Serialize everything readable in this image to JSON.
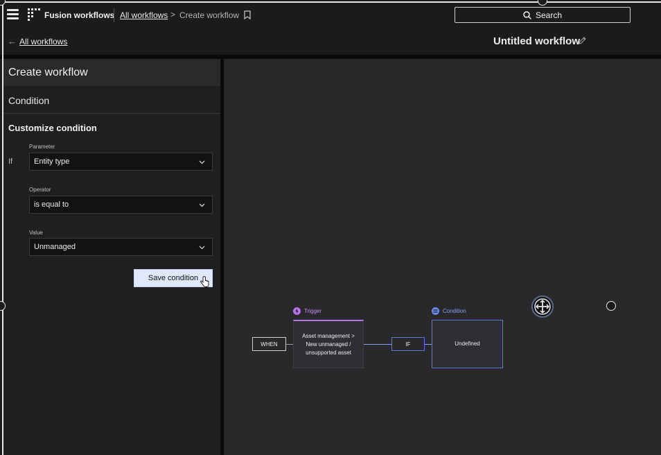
{
  "topbar": {
    "app_title": "Fusion workflows",
    "breadcrumb_link": "All workflows",
    "breadcrumb_separator": ">",
    "breadcrumb_current": "Create workflow",
    "search_label": "Search"
  },
  "subbar": {
    "back_link": "All workflows",
    "workflow_title": "Untitled workflow"
  },
  "panel": {
    "title": "Create workflow",
    "section": "Condition",
    "subtitle": "Customize condition",
    "if_label": "If",
    "parameter": {
      "label": "Parameter",
      "value": "Entity type"
    },
    "operator": {
      "label": "Operator",
      "value": "is equal to"
    },
    "value": {
      "label": "Value",
      "value": "Unmanaged"
    },
    "save_button": "Save condition"
  },
  "canvas": {
    "when_label": "WHEN",
    "trigger": {
      "header": "Trigger",
      "line1": "Asset management >",
      "line2": "New unmanaged /",
      "line3": "unsupported asset"
    },
    "if_label": "IF",
    "condition": {
      "header": "Condition",
      "body": "Undefined"
    }
  },
  "colors": {
    "trigger_accent": "#b674e8",
    "condition_accent": "#5c77d6",
    "save_button_bg": "#e0e8fb"
  }
}
